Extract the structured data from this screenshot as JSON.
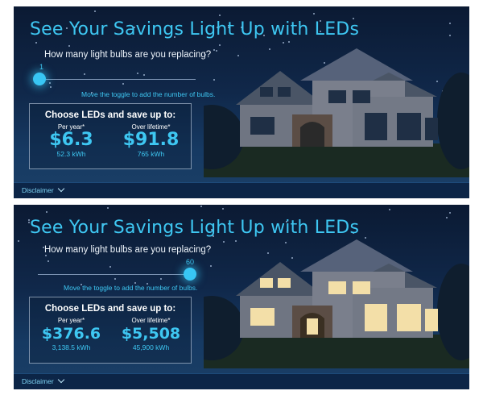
{
  "panels": [
    {
      "headline": "See Your Savings Light Up with LEDs",
      "question": "How many light bulbs are you replacing?",
      "slider_value": "1",
      "slider_level": 0.0,
      "hint": "Move the toggle to add the number of bulbs.",
      "box_title": "Choose LEDs and save up to:",
      "per_year_label": "Per year*",
      "per_year_value": "$6.3",
      "per_year_kwh": "52.3 kWh",
      "lifetime_label": "Over lifetime*",
      "lifetime_value": "$91.8",
      "lifetime_kwh": "765 kWh",
      "disclaimer": "Disclaimer",
      "windows_lit": false
    },
    {
      "headline": "See Your Savings Light Up with LEDs",
      "question": "How many light bulbs are you replacing?",
      "slider_value": "60",
      "slider_level": 1.0,
      "hint": "Move the toggle to add the number of bulbs.",
      "box_title": "Choose LEDs and save up to:",
      "per_year_label": "Per year*",
      "per_year_value": "$376.6",
      "per_year_kwh": "3,138.5 kWh",
      "lifetime_label": "Over lifetime*",
      "lifetime_value": "$5,508",
      "lifetime_kwh": "45,900 kWh",
      "disclaimer": "Disclaimer",
      "windows_lit": true
    }
  ],
  "colors": {
    "accent": "#3ec7f2",
    "sky_top": "#0b1a33",
    "footer": "#0c2547",
    "window_dark": "#1f2f45",
    "window_lit": "#f3dfa8"
  },
  "icons": {
    "disclaimer_toggle": "chevron-down-icon",
    "slider_thumb": "slider-thumb"
  }
}
